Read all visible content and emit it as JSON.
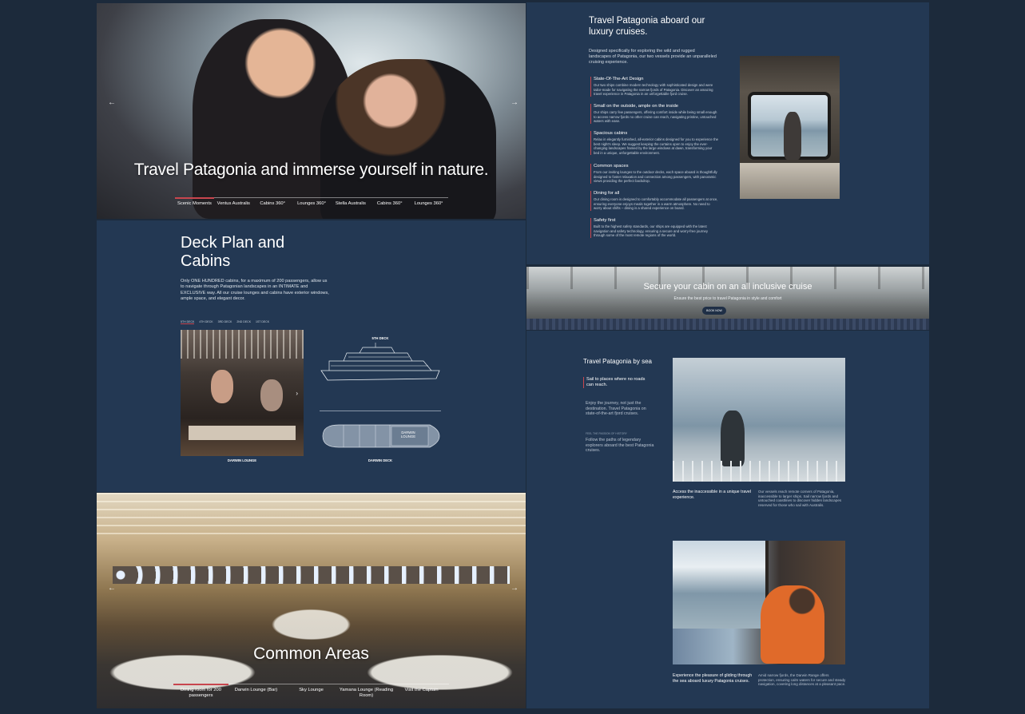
{
  "hero": {
    "title": "Travel Patagonia and immerse yourself in nature.",
    "prev_arrow": "←",
    "next_arrow": "→",
    "tabs": [
      {
        "label": "Scenic Moments"
      },
      {
        "label": "Ventus Australis"
      },
      {
        "label": "Cabins 360°"
      },
      {
        "label": "Lounges 360°"
      },
      {
        "label": "Stella Australis"
      },
      {
        "label": "Cabins 360°"
      },
      {
        "label": "Lounges 360°"
      }
    ]
  },
  "cruise": {
    "title": "Travel Patagonia aboard our luxury cruises.",
    "intro": "Designed specifically for exploring the wild and rugged landscapes of Patagonia, our two vessels provide an unparalleled cruising experience.",
    "features": [
      {
        "title": "State-Of-The-Art Design",
        "desc": "Our two ships combine modern technology with sophisticated design and were tailor-made for navigating the narrow fjords of Patagonia. Discover an amazing travel experience in Patagonia in an unforgettable fjord cruise."
      },
      {
        "title": "Small on the outside, ample on the inside",
        "desc": "Our ships carry few passengers, offering comfort inside while being small enough to access narrow fjords no other cruise can reach, navigating pristine, untouched waters with ease."
      },
      {
        "title": "Spacious cabins",
        "desc": "Relax in elegantly furnished, all-exterior cabins designed for you to experience the best night's sleep. We suggest keeping the curtains open to enjoy the ever-changing landscapes framed by the large windows at dawn, transforming your bed in a unique, unforgettable environment."
      },
      {
        "title": "Common spaces",
        "desc": "From our inviting lounges to the outdoor decks, each space aboard is thoughtfully designed to foster relaxation and connection among passengers, with panoramic views providing the perfect backdrop."
      },
      {
        "title": "Dining for all",
        "desc": "Our dining room is designed to comfortably accommodate all passengers at once, ensuring everyone enjoys meals together in a warm atmosphere. No need to worry about shifts – dining is a shared experience on board."
      },
      {
        "title": "Safety first",
        "desc": "Built to the highest safety standards, our ships are equipped with the latest navigation and safety technology, ensuring a secure and worry-free journey through some of the most remote regions of the world."
      }
    ]
  },
  "secure": {
    "title": "Secure your cabin on an all inclusive cruise",
    "subtitle": "Ensure the best price to travel Patagonia in style and comfort",
    "button": "BOOK NOW"
  },
  "deck": {
    "title_line1": "Deck Plan and",
    "title_line2": "Cabins",
    "description": "Only ONE HUNDRED cabins, for a maximum of 200 passengers, allow us to navigate through Patagonian landscapes in an INTIMATE and EXCLUSIVE way. All our cruise lounges and cabins have exterior windows, ample space, and elegant decor.",
    "nav": [
      "5TH DECK",
      "4TH DECK",
      "3RD DECK",
      "2ND DECK",
      "1ST DECK"
    ],
    "photo_caption": "DARWIN LOUNGE",
    "ship_label": "5TH DECK",
    "plan_room_label_line1": "DARWIN",
    "plan_room_label_line2": "LOUNGE",
    "plan_caption": "DARWIN DECK"
  },
  "common": {
    "title": "Common Areas",
    "tabs": [
      {
        "label": "Dining room for 200 passengers"
      },
      {
        "label": "Darwin Lounge (Bar)"
      },
      {
        "label": "Sky Lounge"
      },
      {
        "label": "Yamana Lounge (Reading Room)"
      },
      {
        "label": "Visit the Captain"
      }
    ]
  },
  "sea": {
    "title": "Travel Patagonia by sea",
    "highlight": "Sail to places where no roads can reach.",
    "p1": "Enjoy the journey, not just the destination. Travel Patagonia on state-of-the-art fjord cruises.",
    "kicker": "FEEL THE PASSION OF HISTORY",
    "p2": "Follow the paths of legendary explorers aboard the best Patagonia cruises.",
    "card1_title": "Access the inaccessible in a unique travel experience.",
    "card1_desc": "Our vessels reach remote corners of Patagonia, inaccessible to larger ships. Sail narrow fjords and untouched coastlines to discover hidden landscapes reserved for those who sail with Australis.",
    "card2_title": "Experience the pleasure of gliding through the sea aboard luxury Patagonia cruises.",
    "card2_desc": "Amid narrow fjords, the Darwin Range offers protection, ensuring calm waters for secure and steady navigation, covering long distances at a pleasant pace."
  },
  "colors": {
    "page_bg": "#1c2a3b",
    "panel_bg": "#233853",
    "accent_red": "#c8464e"
  }
}
